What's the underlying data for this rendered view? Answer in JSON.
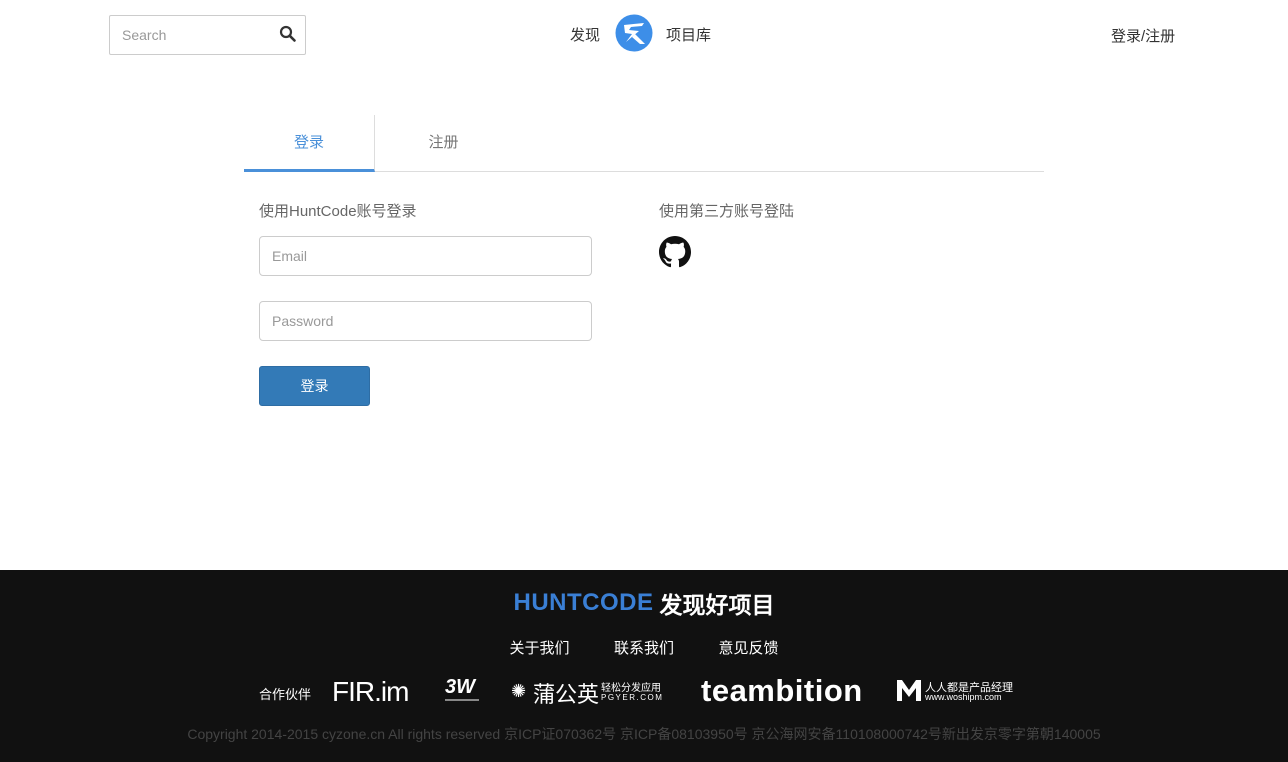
{
  "header": {
    "search_placeholder": "Search",
    "nav_discover": "发现",
    "nav_projects": "项目库",
    "login_register": "登录/注册"
  },
  "tabs": {
    "login": "登录",
    "register": "注册"
  },
  "login_form": {
    "title": "使用HuntCode账号登录",
    "email_placeholder": "Email",
    "password_placeholder": "Password",
    "submit_label": "登录"
  },
  "third_party": {
    "title": "使用第三方账号登陆",
    "icons": [
      "github-icon"
    ]
  },
  "footer": {
    "brand_name": "HUNTCODE",
    "brand_slogan": "发现好项目",
    "links": [
      "关于我们",
      "联系我们",
      "意见反馈"
    ],
    "partners_label": "合作伙伴",
    "partners": {
      "fir": "FIR.im",
      "w3": "3W",
      "pgyer_name": "蒲公英",
      "pgyer_sub": "轻松分发应用",
      "pgyer_en": "PGYER.COM",
      "teambition": "teambition",
      "woshipm_cn": "人人都是产品经理",
      "woshipm_url": "www.woshipm.com"
    },
    "copyright": "Copyright 2014-2015 cyzone.cn All rights reserved 京ICP证070362号 京ICP备08103950号 京公海网安备110108000742号新出发京零字第朝140005"
  },
  "colors": {
    "accent": "#4a90d9",
    "button": "#337ab7",
    "footer_bg": "#111111",
    "brand": "#3a7fd5"
  }
}
